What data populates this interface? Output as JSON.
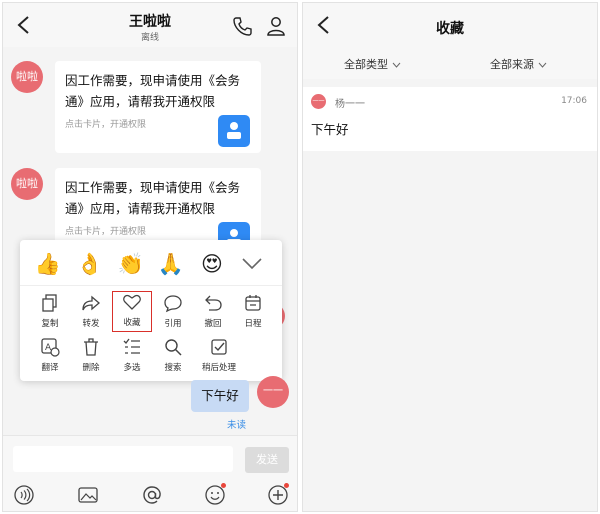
{
  "left": {
    "header": {
      "title": "王啦啦",
      "status": "离线"
    },
    "messages": [
      {
        "avatar": "啦啦",
        "text": "因工作需要，现申请使用《会务通》应用，请帮我开通权限",
        "hint": "点击卡片，开通权限"
      },
      {
        "avatar": "啦啦",
        "text": "因工作需要，现申请使用《会务通》应用，请帮我开通权限",
        "hint": "点击卡片，开通权限"
      }
    ],
    "popup": {
      "emojis": [
        "👍",
        "👌",
        "👏",
        "🙏",
        "😍"
      ],
      "actions": [
        {
          "label": "复制",
          "icon": "copy-icon"
        },
        {
          "label": "转发",
          "icon": "forward-icon"
        },
        {
          "label": "收藏",
          "icon": "heart-icon"
        },
        {
          "label": "引用",
          "icon": "quote-icon"
        },
        {
          "label": "撤回",
          "icon": "undo-icon"
        },
        {
          "label": "日程",
          "icon": "calendar-icon"
        },
        {
          "label": "翻译",
          "icon": "translate-icon"
        },
        {
          "label": "删除",
          "icon": "trash-icon"
        },
        {
          "label": "多选",
          "icon": "multiselect-icon"
        },
        {
          "label": "搜索",
          "icon": "search-icon"
        },
        {
          "label": "稍后处理",
          "icon": "later-icon"
        }
      ]
    },
    "own_message": {
      "text": "下午好",
      "status": "未读",
      "avatar": "一一"
    },
    "input": {
      "placeholder": "",
      "send_label": "发送"
    }
  },
  "right": {
    "title": "收藏",
    "filters": [
      "全部类型",
      "全部来源"
    ],
    "favorite": {
      "avatar": "一一",
      "name": "杨一一",
      "time": "17:06",
      "content": "下午好"
    }
  },
  "colors": {
    "avatar": "#e86c72",
    "highlight": "#d9302a",
    "bubble": "#c7daf4",
    "accent": "#3a8ee6",
    "card_icon": "#2f8af4"
  }
}
